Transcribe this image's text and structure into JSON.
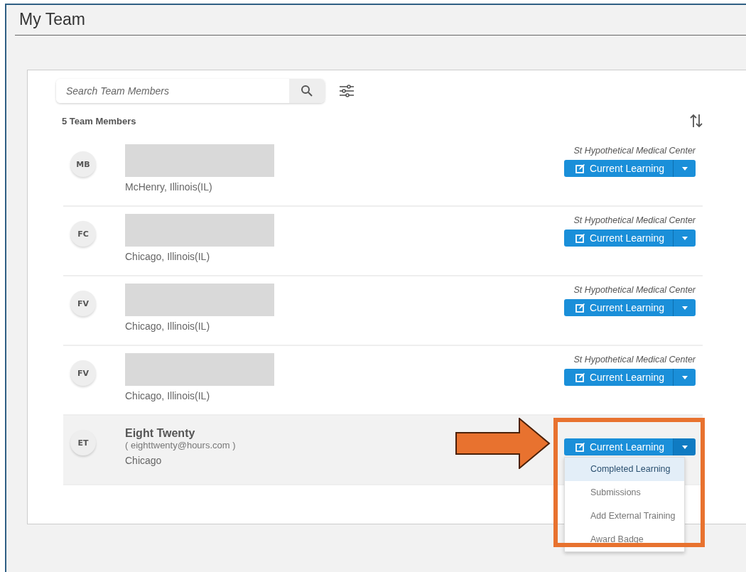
{
  "page": {
    "title": "My Team"
  },
  "search": {
    "placeholder": "Search Team Members"
  },
  "member_count": "5 Team Members",
  "members": [
    {
      "initials": "MB",
      "name_redacted": true,
      "location": "McHenry, Illinois(IL)",
      "organization": "St Hypothetical Medical Center",
      "button": "Current Learning",
      "expanded": false,
      "highlighted": false
    },
    {
      "initials": "FC",
      "name_redacted": true,
      "location": "Chicago, Illinois(IL)",
      "organization": "St Hypothetical Medical Center",
      "button": "Current Learning",
      "expanded": false,
      "highlighted": false
    },
    {
      "initials": "FV",
      "name_redacted": true,
      "location": "Chicago, Illinois(IL)",
      "organization": "St Hypothetical Medical Center",
      "button": "Current Learning",
      "expanded": false,
      "highlighted": false
    },
    {
      "initials": "FV",
      "name_redacted": true,
      "location": "Chicago, Illinois(IL)",
      "organization": "St Hypothetical Medical Center",
      "button": "Current Learning",
      "expanded": false,
      "highlighted": false
    },
    {
      "initials": "ET",
      "name_redacted": false,
      "name": "Eight Twenty",
      "email": "( eighttwenty@hours.com )",
      "location": "Chicago",
      "button": "Current Learning",
      "expanded": true,
      "highlighted": true
    }
  ],
  "dropdown_menu": [
    {
      "label": "Completed Learning",
      "selected": true
    },
    {
      "label": "Submissions",
      "selected": false
    },
    {
      "label": "Add External Training",
      "selected": false
    },
    {
      "label": "Award Badge",
      "selected": false
    }
  ],
  "annotation": {
    "arrow": true,
    "frame": true
  }
}
